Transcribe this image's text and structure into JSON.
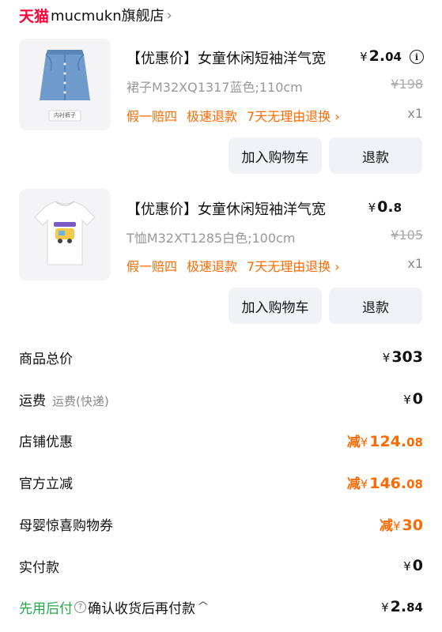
{
  "store": {
    "platform": "天猫",
    "name": "mucmukn旗舰店",
    "chevron": "›"
  },
  "items": [
    {
      "title": "【优惠价】女童休闲短袖洋气宽",
      "price_yen": "¥",
      "price_int": "2.",
      "price_dec": "04",
      "sku": "裙子M32XQ1317蓝色;110cm",
      "orig_price": "¥198",
      "guarantees": [
        "假一赔四",
        "极速退款",
        "7天无理由退换 ›"
      ],
      "qty": "x1",
      "thumb_caption": "内衬裤子",
      "btn_cart": "加入购物车",
      "btn_refund": "退款"
    },
    {
      "title": "【优惠价】女童休闲短袖洋气宽",
      "price_yen": "¥",
      "price_int": "0.",
      "price_dec": "8",
      "sku": "T恤M32XT1285白色;100cm",
      "orig_price": "¥105",
      "guarantees": [
        "假一赔四",
        "极速退款",
        "7天无理由退换 ›"
      ],
      "qty": "x1",
      "thumb_caption": "",
      "btn_cart": "加入购物车",
      "btn_refund": "退款"
    }
  ],
  "summary": {
    "total_label": "商品总价",
    "total_yen": "¥",
    "total_int": "303",
    "total_dec": "",
    "shipping_label": "运费",
    "shipping_sub": "运费(快递)",
    "shipping_yen": "¥",
    "shipping_int": "0",
    "store_discount_label": "店铺优惠",
    "store_discount_prefix": "减",
    "store_discount_yen": "¥",
    "store_discount_int": "124.",
    "store_discount_dec": "08",
    "official_discount_label": "官方立减",
    "official_discount_prefix": "减",
    "official_discount_yen": "¥",
    "official_discount_int": "146.",
    "official_discount_dec": "08",
    "coupon_label": "母婴惊喜购物券",
    "coupon_prefix": "减",
    "coupon_yen": "¥",
    "coupon_int": "30",
    "paid_label": "实付款",
    "paid_yen": "¥",
    "paid_int": "0",
    "paylater_label": "先用后付",
    "paylater_help": "?",
    "paylater_text": "确认收货后再付款",
    "paylater_chevron": "^",
    "paylater_yen": "¥",
    "paylater_int": "2.",
    "paylater_dec": "84"
  },
  "colors": {
    "accent_orange": "#ff6a00",
    "tmall_red": "#ff0036",
    "green": "#25a84a",
    "button_bg": "#f0f2f7"
  }
}
